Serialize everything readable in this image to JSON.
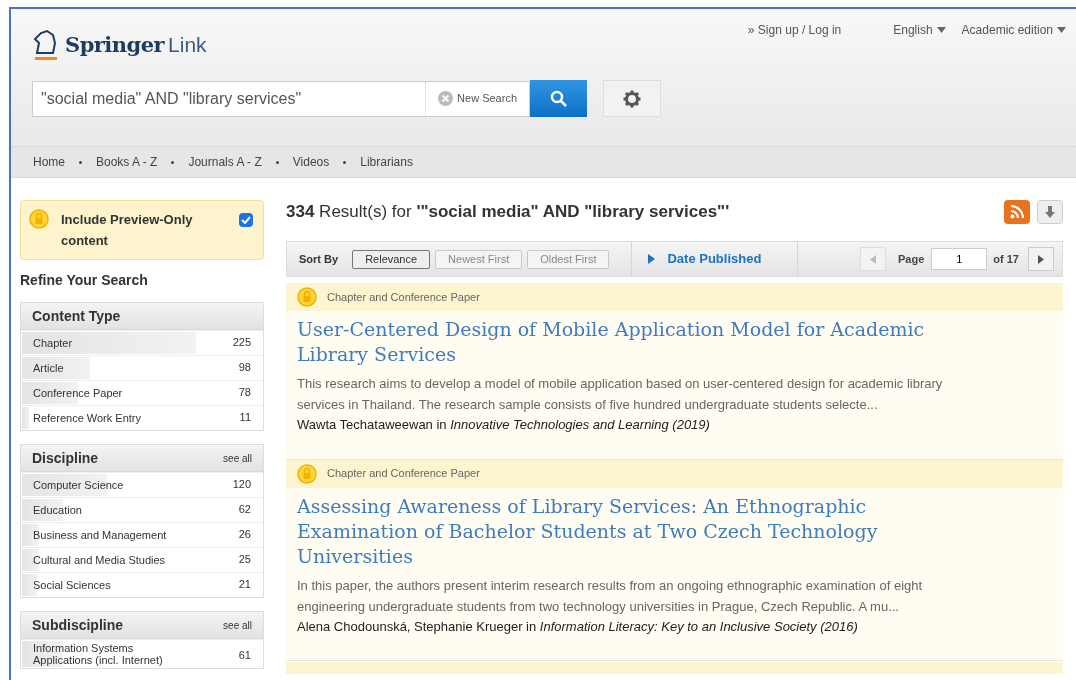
{
  "header": {
    "logo_primary": "Springer",
    "logo_secondary": "Link",
    "account_link": "» Sign up / Log in",
    "language": "English",
    "edition": "Academic edition"
  },
  "search": {
    "value": "\"social media\" AND \"library services\"",
    "clear_label": "New Search"
  },
  "nav": [
    "Home",
    "Books A - Z",
    "Journals A - Z",
    "Videos",
    "Librarians"
  ],
  "preview_toggle": {
    "label": "Include Preview-Only content",
    "checked": true
  },
  "refine_heading": "Refine Your Search",
  "facets": [
    {
      "title": "Content Type",
      "items": [
        {
          "label": "Chapter",
          "count": "225",
          "level": 0.72
        },
        {
          "label": "Article",
          "count": "98",
          "level": 0.28
        },
        {
          "label": "Conference Paper",
          "count": "78",
          "level": 0.23
        },
        {
          "label": "Reference Work Entry",
          "count": "11",
          "level": 0.03
        }
      ]
    },
    {
      "title": "Discipline",
      "see_all": "see all",
      "items": [
        {
          "label": "Computer Science",
          "count": "120",
          "level": 0.35
        },
        {
          "label": "Education",
          "count": "62",
          "level": 0.17
        },
        {
          "label": "Business and Management",
          "count": "26",
          "level": 0.07
        },
        {
          "label": "Cultural and Media Studies",
          "count": "25",
          "level": 0.07
        },
        {
          "label": "Social Sciences",
          "count": "21",
          "level": 0.06
        }
      ]
    },
    {
      "title": "Subdiscipline",
      "see_all": "see all",
      "items": [
        {
          "label": "Information Systems Applications (incl. Internet)",
          "count": "61",
          "level": 0.17
        }
      ]
    }
  ],
  "results_heading": "**334** Result(s) for **'\"social media\" AND \"library services\"'**",
  "sort": {
    "label": "Sort By",
    "options": [
      {
        "label": "Relevance",
        "selected": true
      },
      {
        "label": "Newest First",
        "selected": false
      },
      {
        "label": "Oldest First",
        "selected": false
      }
    ],
    "date_filter": "Date Published"
  },
  "pagination": {
    "label": "Page",
    "value": "1",
    "total": "of 17"
  },
  "results": [
    {
      "type": "Chapter and Conference Paper",
      "title": "User-Centered Design of Mobile Application Model for Academic Library Services",
      "snippet": "This research aims to develop a model of mobile application based on user-centered design for academic library services in Thailand. The research sample consists of five hundred undergraduate students selecte...",
      "source": "Wawta Techataweewan in *Innovative Technologies and Learning (2019)*"
    },
    {
      "type": "Chapter and Conference Paper",
      "title": "Assessing Awareness of Library Services: An Ethnographic Examination of Bachelor Students at Two Czech Technology Universities",
      "snippet": "In this paper, the authors present interim research results from an ongoing ethnographic examination of eight engineering undergraduate students from two technology universities in Prague, Czech Republic. A mu...",
      "source": "Alena Chodounská, Stephanie Krueger in *Information Literacy: Key to an Inclusive Society (2016)*"
    }
  ]
}
